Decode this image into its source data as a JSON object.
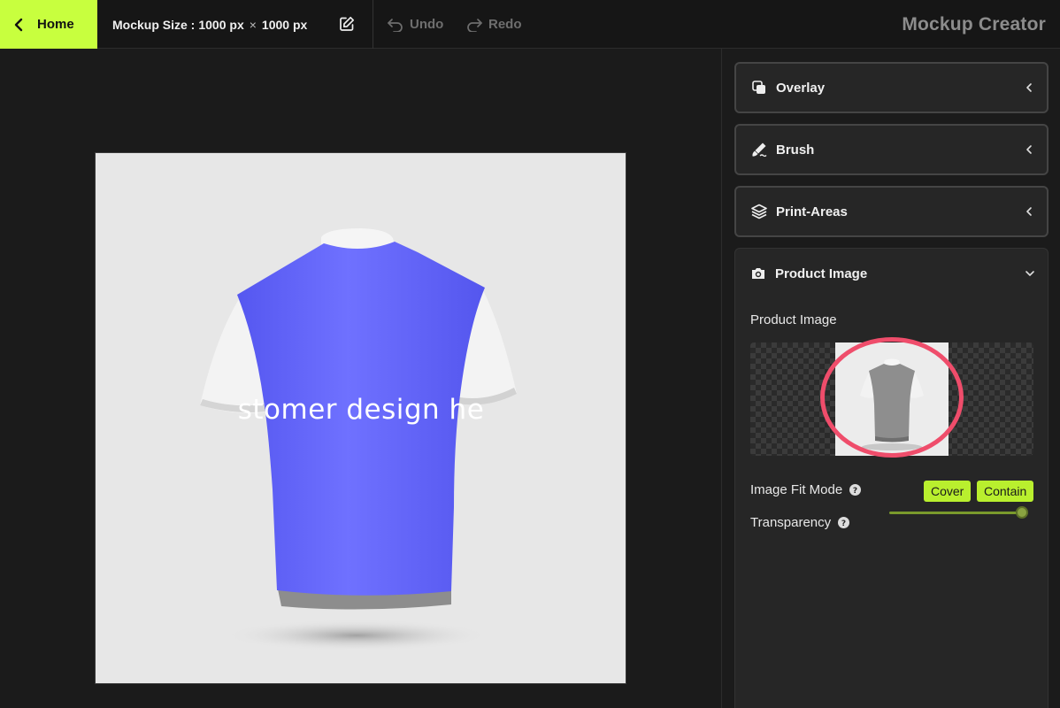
{
  "topbar": {
    "home_label": "Home",
    "mockup_size_label": "Mockup Size :",
    "width": "1000 px",
    "times": "×",
    "height": "1000 px",
    "undo_label": "Undo",
    "redo_label": "Redo",
    "app_title": "Mockup Creator"
  },
  "canvas": {
    "design_text": "stomer design he",
    "shirt_color": "#6a6cff"
  },
  "sidebar": {
    "panels": [
      {
        "label": "Overlay",
        "icon": "copy-icon",
        "state": "collapsed"
      },
      {
        "label": "Brush",
        "icon": "brush-icon",
        "state": "collapsed"
      },
      {
        "label": "Print-Areas",
        "icon": "layers-icon",
        "state": "collapsed"
      }
    ],
    "product_image": {
      "title": "Product Image",
      "icon": "camera-icon",
      "state": "expanded",
      "field_label": "Product Image",
      "fit_mode_label": "Image Fit Mode",
      "fit_options": [
        "Cover",
        "Contain"
      ],
      "transparency_label": "Transparency",
      "transparency_value": 1.0
    }
  },
  "colors": {
    "accent": "#c8ff3e",
    "highlight": "#ef4d6b",
    "panel_bg": "#262626"
  }
}
